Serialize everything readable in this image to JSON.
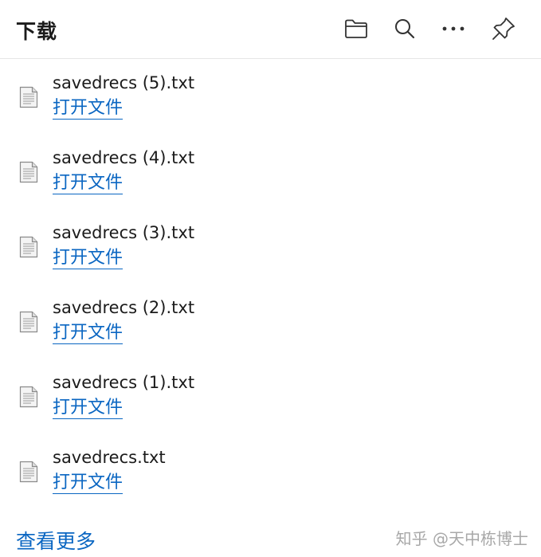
{
  "header": {
    "title": "下载",
    "actions": [
      {
        "name": "folder-icon"
      },
      {
        "name": "search-icon"
      },
      {
        "name": "more-icon"
      },
      {
        "name": "pin-icon"
      }
    ]
  },
  "downloads": [
    {
      "file_name": "savedrecs (5).txt",
      "action": "打开文件"
    },
    {
      "file_name": "savedrecs (4).txt",
      "action": "打开文件"
    },
    {
      "file_name": "savedrecs (3).txt",
      "action": "打开文件"
    },
    {
      "file_name": "savedrecs (2).txt",
      "action": "打开文件"
    },
    {
      "file_name": "savedrecs (1).txt",
      "action": "打开文件"
    },
    {
      "file_name": "savedrecs.txt",
      "action": "打开文件"
    }
  ],
  "footer": {
    "see_more": "查看更多",
    "watermark": "知乎 @天中栋博士"
  },
  "colors": {
    "link": "#0a66c2",
    "text": "#1b1b1b",
    "divider": "#e6e6e6",
    "watermark": "#a8a8a8"
  }
}
